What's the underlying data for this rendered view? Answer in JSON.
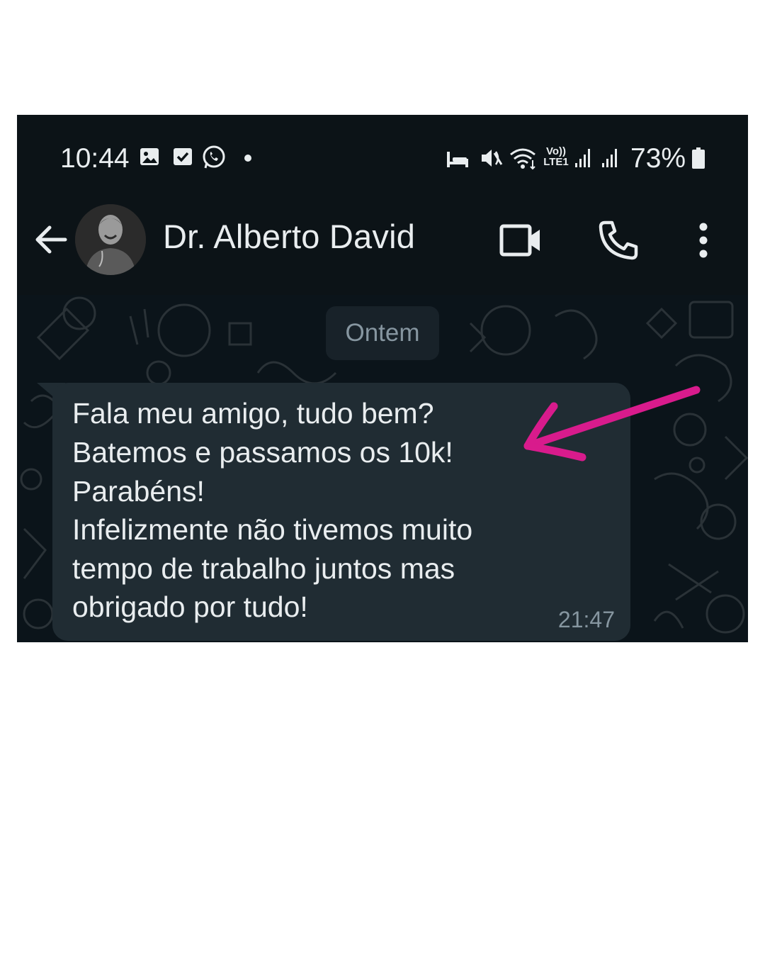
{
  "status_bar": {
    "time": "10:44",
    "battery": "73%",
    "left_icons": [
      "gallery-icon",
      "check-square-icon",
      "whatsapp-icon",
      "dot"
    ],
    "right_icons": [
      "sleep-bed-icon",
      "mute-icon",
      "wifi-icon",
      "volte-icon",
      "signal-icon",
      "signal-icon",
      "battery-icon"
    ],
    "volte_label": "Vo))",
    "lte_label": "LTE1"
  },
  "header": {
    "contact_name": "Dr. Alberto David",
    "icons": [
      "back-arrow-icon",
      "video-call-icon",
      "phone-icon",
      "more-vert-icon"
    ]
  },
  "chat": {
    "date_chip": "Ontem",
    "message": {
      "lines": [
        "Fala meu amigo, tudo bem?",
        "Batemos e passamos os 10k!",
        "Parabéns!",
        "Infelizmente não tivemos muito",
        "tempo de trabalho juntos mas",
        "obrigado por tudo!"
      ],
      "time": "21:47"
    }
  },
  "annotation": {
    "arrow_color": "#d81b8c"
  },
  "colors": {
    "bar_bg": "#0c1317",
    "chat_bg": "#0b141a",
    "bubble_bg": "#202c33",
    "text": "#e9edef",
    "muted": "#8696a0"
  }
}
